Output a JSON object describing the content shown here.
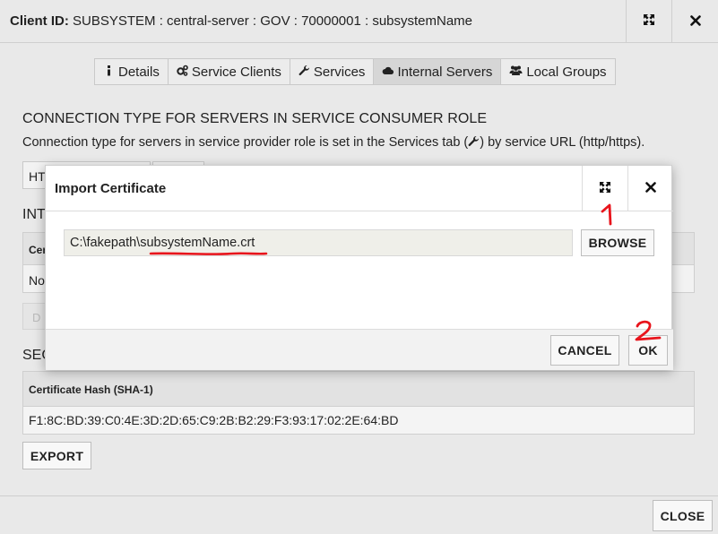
{
  "window": {
    "title_label": "Client ID:",
    "title_value": "SUBSYSTEM : central-server : GOV : 70000001 : subsystemName",
    "expand_icon": "expand-arrows-icon",
    "close_icon": "close-x-icon"
  },
  "tabs": [
    {
      "label": "Details",
      "icon": "info-icon"
    },
    {
      "label": "Service Clients",
      "icon": "gears-icon"
    },
    {
      "label": "Services",
      "icon": "wrench-icon"
    },
    {
      "label": "Internal Servers",
      "icon": "cloud-icon",
      "active": true
    },
    {
      "label": "Local Groups",
      "icon": "users-icon"
    }
  ],
  "connection": {
    "heading": "CONNECTION TYPE FOR SERVERS IN SERVICE CONSUMER ROLE",
    "desc_before": "Connection type for servers in service provider role is set in the Services tab (",
    "desc_after": ") by service URL (http/https).",
    "select_value_partial": "HT"
  },
  "internal": {
    "heading_partial": "INT",
    "col_partial": "Cer",
    "row_partial": "No",
    "disabled_btn_partial": "D"
  },
  "security": {
    "heading_partial": "SEC",
    "cert_hash_header": "Certificate Hash (SHA-1)",
    "cert_hash_value": "F1:8C:BD:39:C0:4E:3D:2D:65:C9:2B:B2:29:F3:93:17:02:2E:64:BD",
    "export_label": "EXPORT"
  },
  "footer": {
    "close_label": "CLOSE"
  },
  "import_modal": {
    "title": "Import Certificate",
    "file_path_prefix": "C:\\fakepath\\",
    "file_name": "subsystemName.crt",
    "browse_label": "BROWSE",
    "cancel_label": "CANCEL",
    "ok_label": "OK"
  },
  "annotations": {
    "step1": "1",
    "step2": "2",
    "color": "#e8141c"
  }
}
